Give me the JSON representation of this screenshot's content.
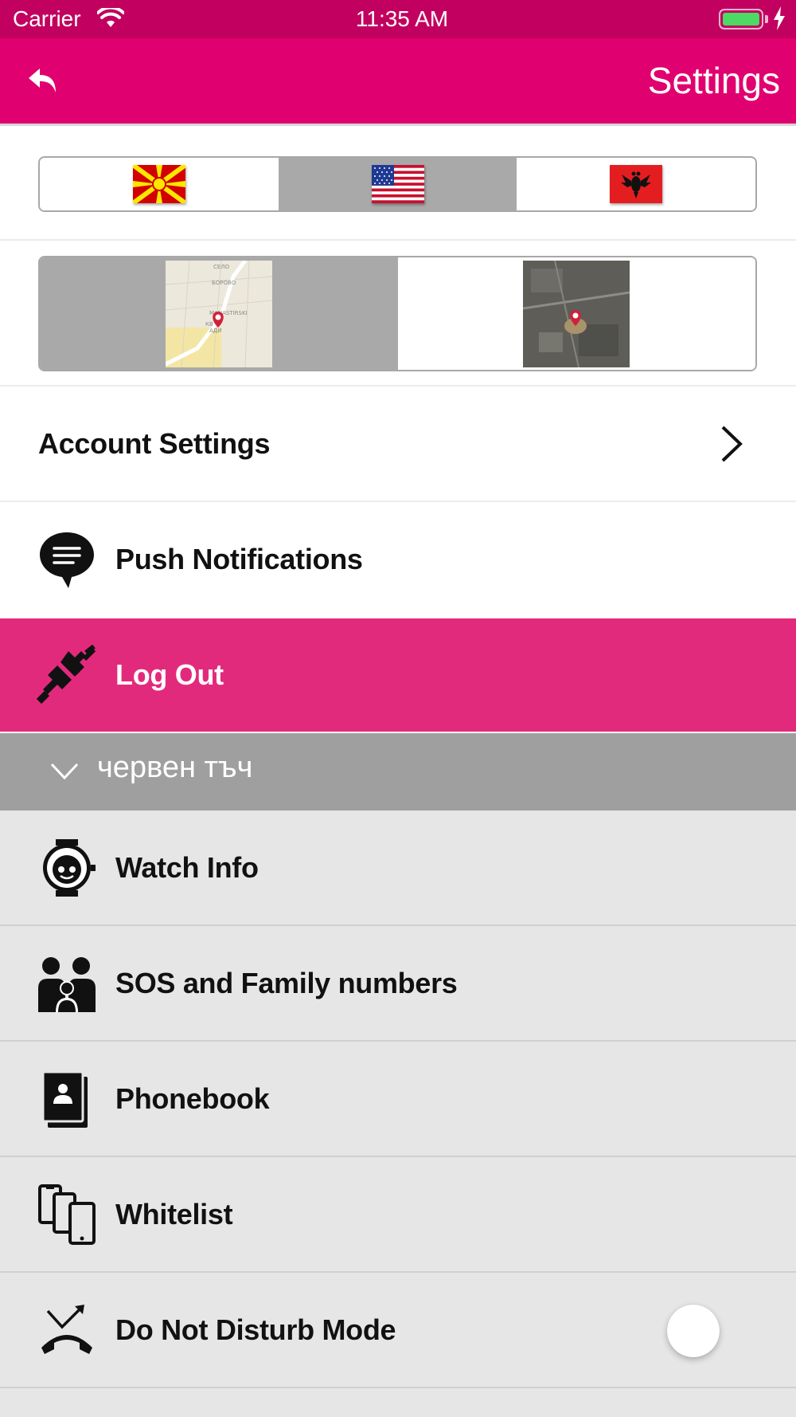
{
  "status_bar": {
    "carrier": "Carrier",
    "time": "11:35 AM",
    "battery_color": "#4cd964"
  },
  "nav": {
    "title": "Settings",
    "back_icon": "back-arrow-icon",
    "bar_color": "#e0006f"
  },
  "language_selector": {
    "options": [
      {
        "flag": "macedonia-flag",
        "selected": false
      },
      {
        "flag": "usa-flag",
        "selected": true
      },
      {
        "flag": "albania-flag",
        "selected": false
      }
    ]
  },
  "map_type_selector": {
    "options": [
      {
        "type": "standard-map",
        "selected": true
      },
      {
        "type": "satellite-map",
        "selected": false
      }
    ]
  },
  "menu": {
    "account_settings": "Account Settings",
    "push_notifications": "Push Notifications",
    "log_out": "Log Out"
  },
  "device": {
    "name": "червен тъч",
    "items": [
      {
        "label": "Watch Info",
        "icon": "watch-icon"
      },
      {
        "label": "SOS and Family numbers",
        "icon": "family-icon"
      },
      {
        "label": "Phonebook",
        "icon": "phonebook-icon"
      },
      {
        "label": "Whitelist",
        "icon": "whitelist-icon"
      },
      {
        "label": "Do Not Disturb Mode",
        "icon": "do-not-disturb-icon",
        "toggle_on": false
      }
    ]
  },
  "colors": {
    "accent": "#e22a7d",
    "group_header": "#9f9f9f"
  }
}
